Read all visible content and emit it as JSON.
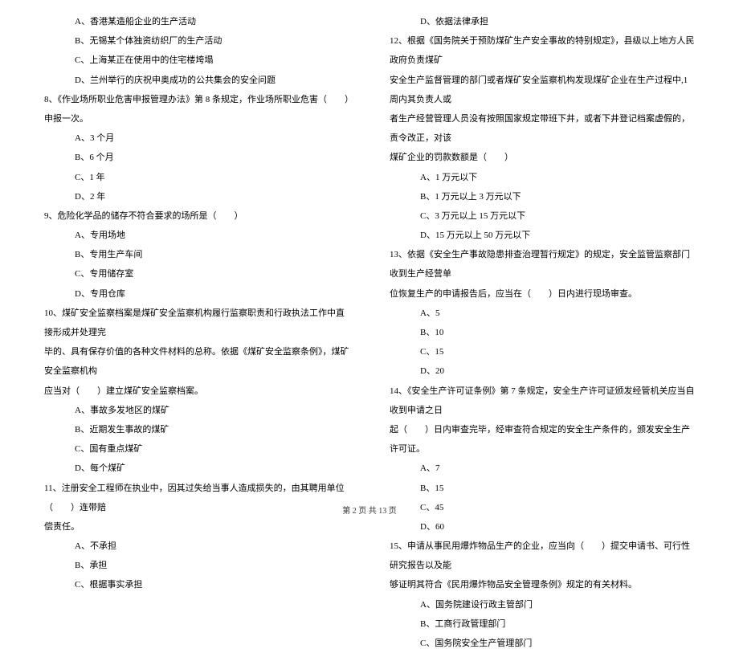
{
  "col1": {
    "q7_optA": "A、香港某造船企业的生产活动",
    "q7_optB": "B、无锡某个体独资纺织厂的生产活动",
    "q7_optC": "C、上海某正在使用中的住宅楼垮塌",
    "q7_optD": "D、兰州举行的庆祝申奥成功的公共集会的安全问题",
    "q8": "8、《作业场所职业危害申报管理办法》第 8 条规定，作业场所职业危害（　　）申报一次。",
    "q8_optA": "A、3 个月",
    "q8_optB": "B、6 个月",
    "q8_optC": "C、1 年",
    "q8_optD": "D、2 年",
    "q9": "9、危险化学品的储存不符合要求的场所是（　　）",
    "q9_optA": "A、专用场地",
    "q9_optB": "B、专用生产车间",
    "q9_optC": "C、专用储存室",
    "q9_optD": "D、专用仓库",
    "q10_l1": "10、煤矿安全监察档案是煤矿安全监察机构履行监察职责和行政执法工作中直接形成并处理完",
    "q10_l2": "毕的、具有保存价值的各种文件材料的总称。依据《煤矿安全监察条例》，煤矿安全监察机构",
    "q10_l3": "应当对（　　）建立煤矿安全监察档案。",
    "q10_optA": "A、事故多发地区的煤矿",
    "q10_optB": "B、近期发生事故的煤矿",
    "q10_optC": "C、国有重点煤矿",
    "q10_optD": "D、每个煤矿",
    "q11_l1": "11、注册安全工程师在执业中，因其过失给当事人造成损失的，由其聘用单位（　　）连带赔",
    "q11_l2": "偿责任。",
    "q11_optA": "A、不承担",
    "q11_optB": "B、承担",
    "q11_optC": "C、根据事实承担"
  },
  "col2": {
    "q11_optD": "D、依据法律承担",
    "q12_l1": "12、根据《国务院关于预防煤矿生产安全事故的特别规定》，县级以上地方人民政府负责煤矿",
    "q12_l2": "安全生产监督管理的部门或者煤矿安全监察机构发现煤矿企业在生产过程中,1 周内其负责人或",
    "q12_l3": "者生产经营管理人员没有按照国家规定带班下井，或者下井登记档案虚假的，责令改正，对该",
    "q12_l4": "煤矿企业的罚款数额是（　　）",
    "q12_optA": "A、1 万元以下",
    "q12_optB": "B、1 万元以上 3 万元以下",
    "q12_optC": "C、3 万元以上 15 万元以下",
    "q12_optD": "D、15 万元以上 50 万元以下",
    "q13_l1": "13、依据《安全生产事故隐患排查治理暂行规定》的规定，安全监管监察部门收到生产经营单",
    "q13_l2": "位恢复生产的申请报告后，应当在（　　）日内进行现场审查。",
    "q13_optA": "A、5",
    "q13_optB": "B、10",
    "q13_optC": "C、15",
    "q13_optD": "D、20",
    "q14_l1": "14、《安全生产许可证条例》第 7 条规定，安全生产许可证颁发经管机关应当自收到申请之日",
    "q14_l2": "起（　　）日内审查完毕，经审查符合规定的安全生产条件的，颁发安全生产许可证。",
    "q14_optA": "A、7",
    "q14_optB": "B、15",
    "q14_optC": "C、45",
    "q14_optD": "D、60",
    "q15_l1": "15、申请从事民用爆炸物品生产的企业，应当向（　　）提交申请书、可行性研究报告以及能",
    "q15_l2": "够证明其符合《民用爆炸物品安全管理条例》规定的有关材料。",
    "q15_optA": "A、国务院建设行政主管部门",
    "q15_optB": "B、工商行政管理部门",
    "q15_optC": "C、国务院安全生产管理部门"
  },
  "footer": "第 2 页 共 13 页"
}
